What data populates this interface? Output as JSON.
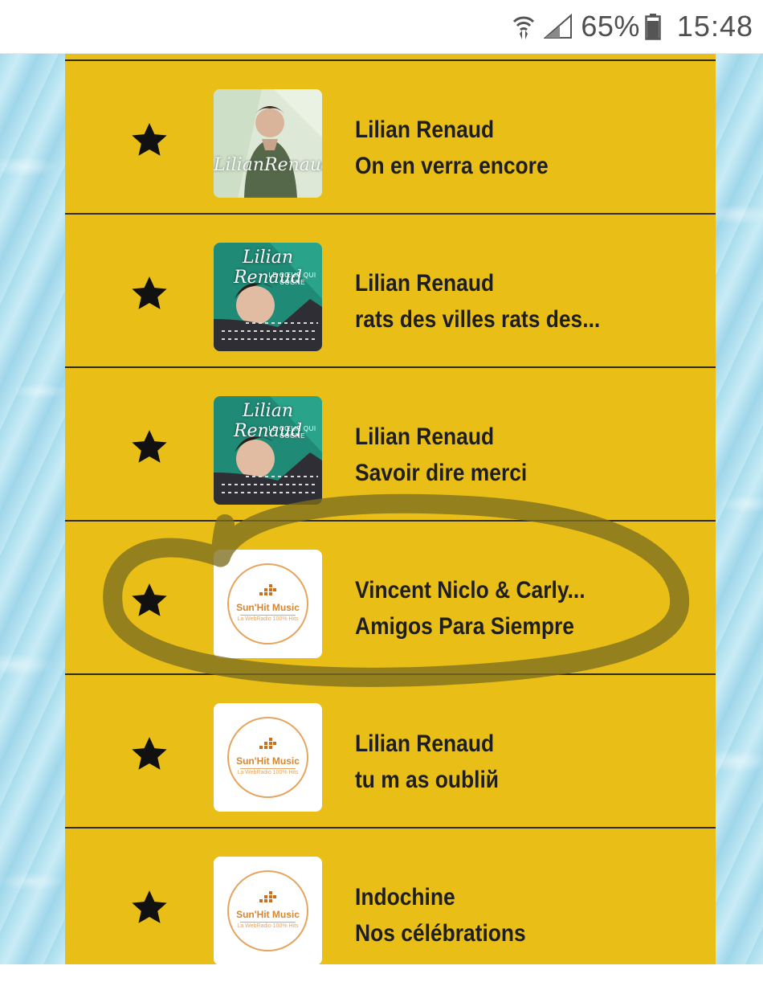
{
  "status_bar": {
    "icons": [
      "wifi-data-icon",
      "signal-icon",
      "battery-icon"
    ],
    "battery_percent": "65%",
    "time": "15:48"
  },
  "colors": {
    "panel": "#e9bf17",
    "text": "#1e1e1e",
    "divider": "#2b2b2b",
    "water": "#b4e2f0",
    "annotation": "#7c6e1d"
  },
  "tracks": [
    {
      "artist": "Lilian Renaud",
      "title": "On en verra encore",
      "cover": "lilian-green-photo",
      "cover_text": "LilianRenaud",
      "favorite_icon": "star-icon"
    },
    {
      "artist": "Lilian Renaud",
      "title": "rats des villes rats des...",
      "cover": "lilian-album-photo",
      "cover_text": "Lilian Renaud",
      "cover_subtext": "LE CŒUR QUI COGNE",
      "favorite_icon": "star-icon"
    },
    {
      "artist": "Lilian Renaud",
      "title": "Savoir dire merci",
      "cover": "lilian-album-photo",
      "cover_text": "Lilian Renaud",
      "cover_subtext": "LE CŒUR QUI COGNE",
      "favorite_icon": "star-icon"
    },
    {
      "artist": "Vincent Niclo & Carly...",
      "title": "Amigos Para Siempre",
      "cover": "sunhit-logo",
      "logo_name": "Sun'Hit Music",
      "logo_tagline": "La WebRadio 100% Hits",
      "favorite_icon": "star-icon",
      "annotated": true
    },
    {
      "artist": "Lilian Renaud",
      "title": "tu m as oubliй",
      "cover": "sunhit-logo",
      "logo_name": "Sun'Hit Music",
      "logo_tagline": "La WebRadio 100% Hits",
      "favorite_icon": "star-icon"
    },
    {
      "artist": "Indochine",
      "title": "Nos célébrations",
      "cover": "sunhit-logo",
      "logo_name": "Sun'Hit Music",
      "logo_tagline": "La WebRadio 100% Hits",
      "favorite_icon": "star-icon"
    }
  ]
}
